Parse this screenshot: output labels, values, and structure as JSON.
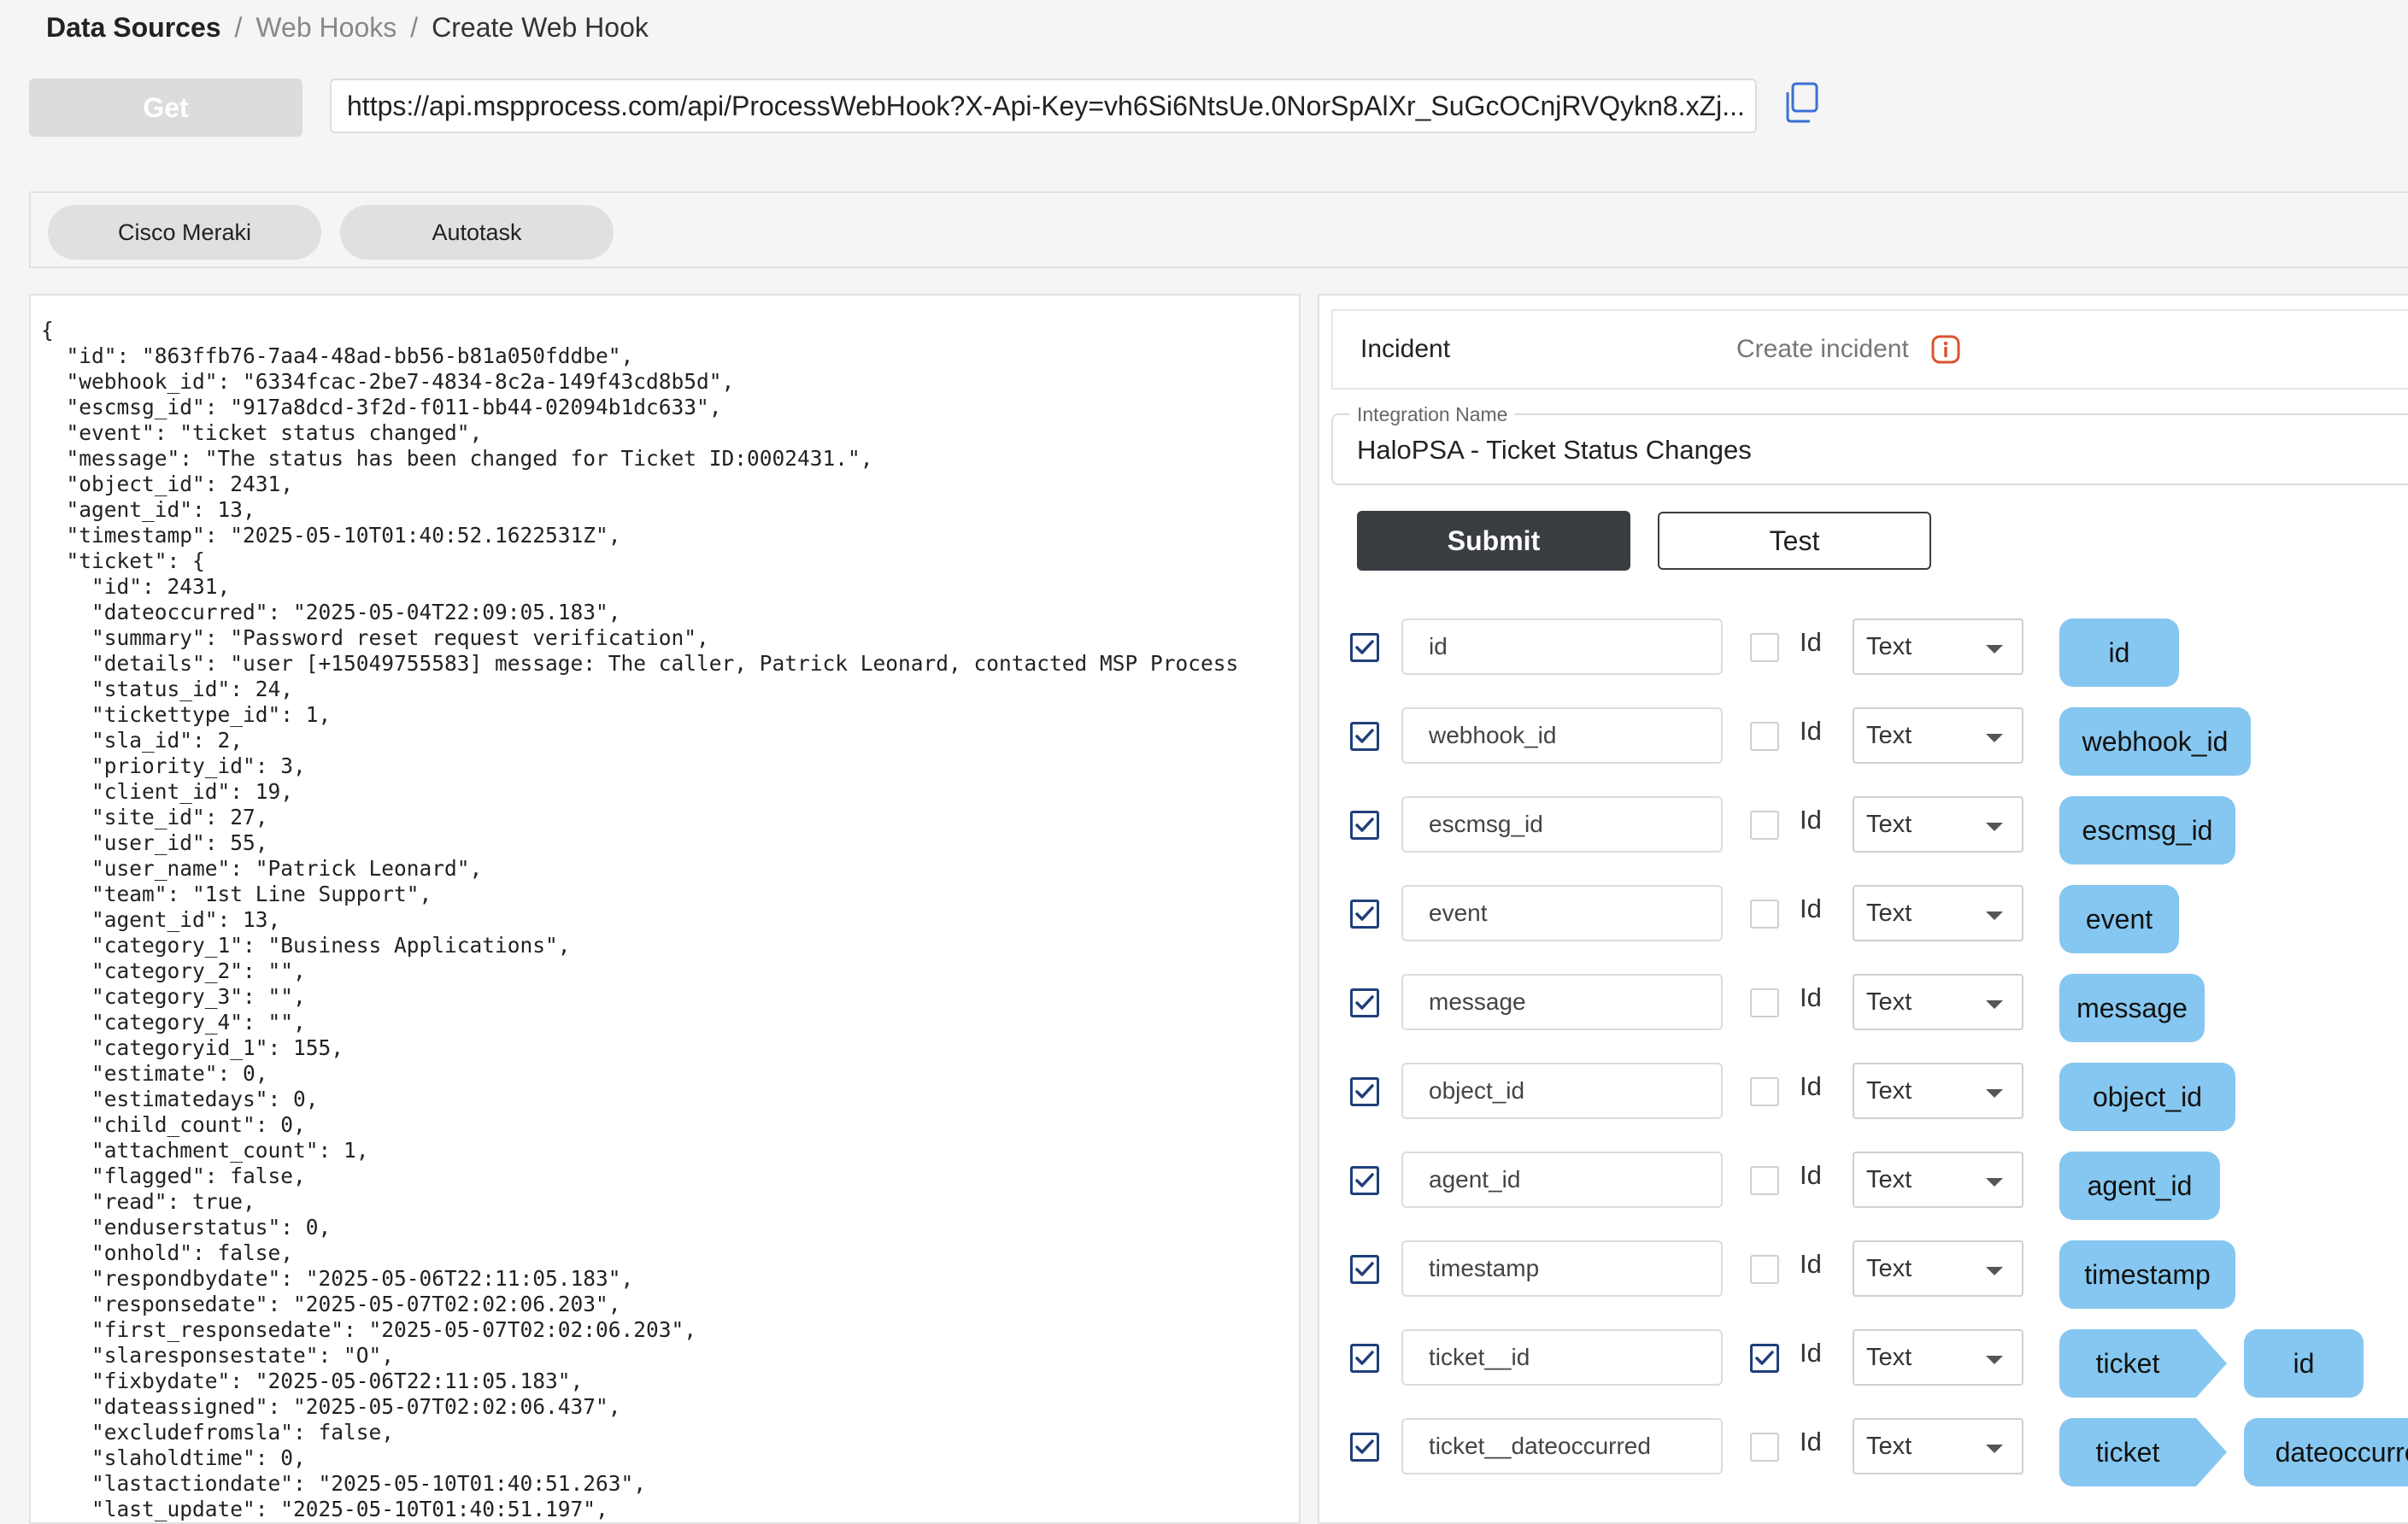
{
  "breadcrumb": {
    "root": "Data Sources",
    "separator": "/",
    "middle": "Web Hooks",
    "current": "Create Web Hook"
  },
  "get_button": "Get",
  "url": "https://api.mspprocess.com/api/ProcessWebHook?X-Api-Key=vh6Si6NtsUe.0NorSpAlXr_SuGcOCnjRVQykn8.xZj...",
  "sources": [
    "Cisco Meraki",
    "Autotask"
  ],
  "json_lines": [
    "{",
    "  \"id\": \"863ffb76-7aa4-48ad-bb56-b81a050fddbe\",",
    "  \"webhook_id\": \"6334fcac-2be7-4834-8c2a-149f43cd8b5d\",",
    "  \"escmsg_id\": \"917a8dcd-3f2d-f011-bb44-02094b1dc633\",",
    "  \"event\": \"ticket status changed\",",
    "  \"message\": \"The status has been changed for Ticket ID:0002431.\",",
    "  \"object_id\": 2431,",
    "  \"agent_id\": 13,",
    "  \"timestamp\": \"2025-05-10T01:40:52.1622531Z\",",
    "  \"ticket\": {",
    "    \"id\": 2431,",
    "    \"dateoccurred\": \"2025-05-04T22:09:05.183\",",
    "    \"summary\": \"Password reset request verification\",",
    "    \"details\": \"user [+15049755583] message: The caller, Patrick Leonard, contacted MSP Process",
    "    \"status_id\": 24,",
    "    \"tickettype_id\": 1,",
    "    \"sla_id\": 2,",
    "    \"priority_id\": 3,",
    "    \"client_id\": 19,",
    "    \"site_id\": 27,",
    "    \"user_id\": 55,",
    "    \"user_name\": \"Patrick Leonard\",",
    "    \"team\": \"1st Line Support\",",
    "    \"agent_id\": 13,",
    "    \"category_1\": \"Business Applications\",",
    "    \"category_2\": \"\",",
    "    \"category_3\": \"\",",
    "    \"category_4\": \"\",",
    "    \"categoryid_1\": 155,",
    "    \"estimate\": 0,",
    "    \"estimatedays\": 0,",
    "    \"child_count\": 0,",
    "    \"attachment_count\": 1,",
    "    \"flagged\": false,",
    "    \"read\": true,",
    "    \"enduserstatus\": 0,",
    "    \"onhold\": false,",
    "    \"respondbydate\": \"2025-05-06T22:11:05.183\",",
    "    \"responsedate\": \"2025-05-07T02:02:06.203\",",
    "    \"first_responsedate\": \"2025-05-07T02:02:06.203\",",
    "    \"slaresponsestate\": \"O\",",
    "    \"fixbydate\": \"2025-05-06T22:11:05.183\",",
    "    \"dateassigned\": \"2025-05-07T02:02:06.437\",",
    "    \"excludefromsla\": false,",
    "    \"slaholdtime\": 0,",
    "    \"lastactiondate\": \"2025-05-10T01:40:51.263\",",
    "    \"last_update\": \"2025-05-10T01:40:51.197\","
  ],
  "incident": {
    "label": "Incident",
    "create_label": "Create incident"
  },
  "integration": {
    "label": "Integration Name",
    "value": "HaloPSA - Ticket Status Changes"
  },
  "submit_label": "Submit",
  "test_label": "Test",
  "fields": [
    {
      "name": "id",
      "checked": true,
      "is_id": false,
      "id_label": "Id",
      "type": "Text",
      "path": [
        "id"
      ]
    },
    {
      "name": "webhook_id",
      "checked": true,
      "is_id": false,
      "id_label": "Id",
      "type": "Text",
      "path": [
        "webhook_id"
      ]
    },
    {
      "name": "escmsg_id",
      "checked": true,
      "is_id": false,
      "id_label": "Id",
      "type": "Text",
      "path": [
        "escmsg_id"
      ]
    },
    {
      "name": "event",
      "checked": true,
      "is_id": false,
      "id_label": "Id",
      "type": "Text",
      "path": [
        "event"
      ]
    },
    {
      "name": "message",
      "checked": true,
      "is_id": false,
      "id_label": "Id",
      "type": "Text",
      "path": [
        "message"
      ]
    },
    {
      "name": "object_id",
      "checked": true,
      "is_id": false,
      "id_label": "Id",
      "type": "Text",
      "path": [
        "object_id"
      ]
    },
    {
      "name": "agent_id",
      "checked": true,
      "is_id": false,
      "id_label": "Id",
      "type": "Text",
      "path": [
        "agent_id"
      ]
    },
    {
      "name": "timestamp",
      "checked": true,
      "is_id": false,
      "id_label": "Id",
      "type": "Text",
      "path": [
        "timestamp"
      ]
    },
    {
      "name": "ticket__id",
      "checked": true,
      "is_id": true,
      "id_label": "Id",
      "type": "Text",
      "path": [
        "ticket",
        "id"
      ]
    },
    {
      "name": "ticket__dateoccurred",
      "checked": true,
      "is_id": false,
      "id_label": "Id",
      "type": "Text",
      "path": [
        "ticket",
        "dateoccurred"
      ]
    }
  ],
  "colors": {
    "chip": "#85c7f0",
    "check": "#1f3f7a",
    "submit": "#3a3d42",
    "info": "#d9532c"
  }
}
